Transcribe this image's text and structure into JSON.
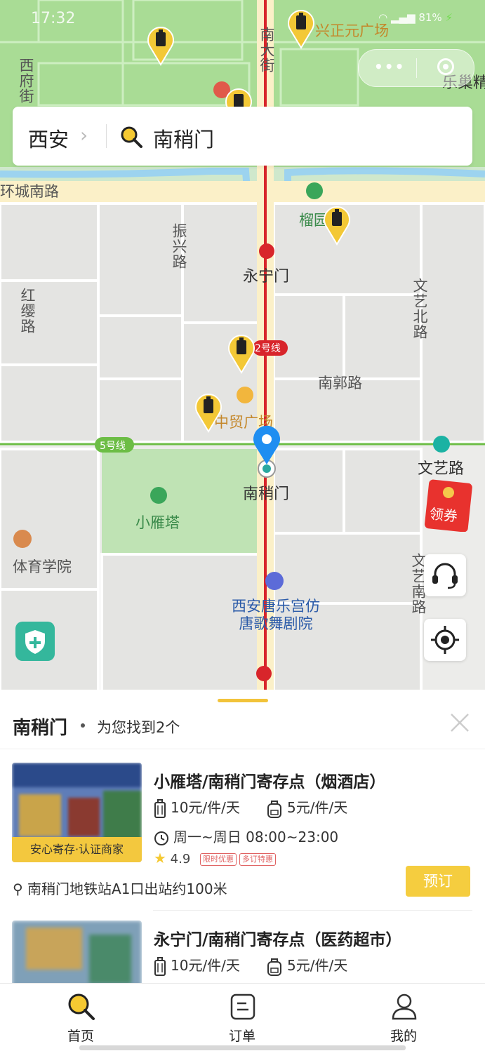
{
  "status_bar": {
    "time": "17:32",
    "battery": "81%"
  },
  "search": {
    "city": "西安",
    "query": "南稍门"
  },
  "map": {
    "roads": [
      "环城南路",
      "南大街",
      "振兴路",
      "红缨路",
      "文艺北路",
      "南郭路",
      "文艺南路",
      "西府街"
    ],
    "places": [
      "兴正元广场",
      "榴园",
      "永宁门",
      "中贸广场",
      "南稍门",
      "小雁塔",
      "体育学院",
      "西安唐乐宫仿唐歌舞剧院",
      "文艺路",
      "乐巢精"
    ],
    "metro_lines": [
      "2号线",
      "5号线"
    ],
    "coupon_label": "领券"
  },
  "results": {
    "location": "南稍门",
    "count_text": "为您找到2个",
    "items": [
      {
        "name": "小雁塔/南稍门寄存点（烟酒店）",
        "price_luggage": "10元/件/天",
        "price_bag": "5元/件/天",
        "hours": "周一~周日 08:00~23:00",
        "rating": "4.9",
        "tags": [
          "限时优惠",
          "多订特惠"
        ],
        "cert": "安心寄存·认证商家",
        "address": "南稍门地铁站A1口出站约100米",
        "book_label": "预订"
      },
      {
        "name": "永宁门/南稍门寄存点（医药超市）",
        "price_luggage": "10元/件/天",
        "price_bag": "5元/件/天"
      }
    ]
  },
  "tabbar": [
    {
      "label": "首页",
      "icon": "search-icon",
      "active": true
    },
    {
      "label": "订单",
      "icon": "order-icon",
      "active": false
    },
    {
      "label": "我的",
      "icon": "user-icon",
      "active": false
    }
  ],
  "colors": {
    "accent": "#f5cd3f",
    "pin_blue": "#1f8ef1",
    "metro_red": "#d8252b",
    "metro_green": "#6cbd45",
    "tag_red": "#e06262"
  }
}
